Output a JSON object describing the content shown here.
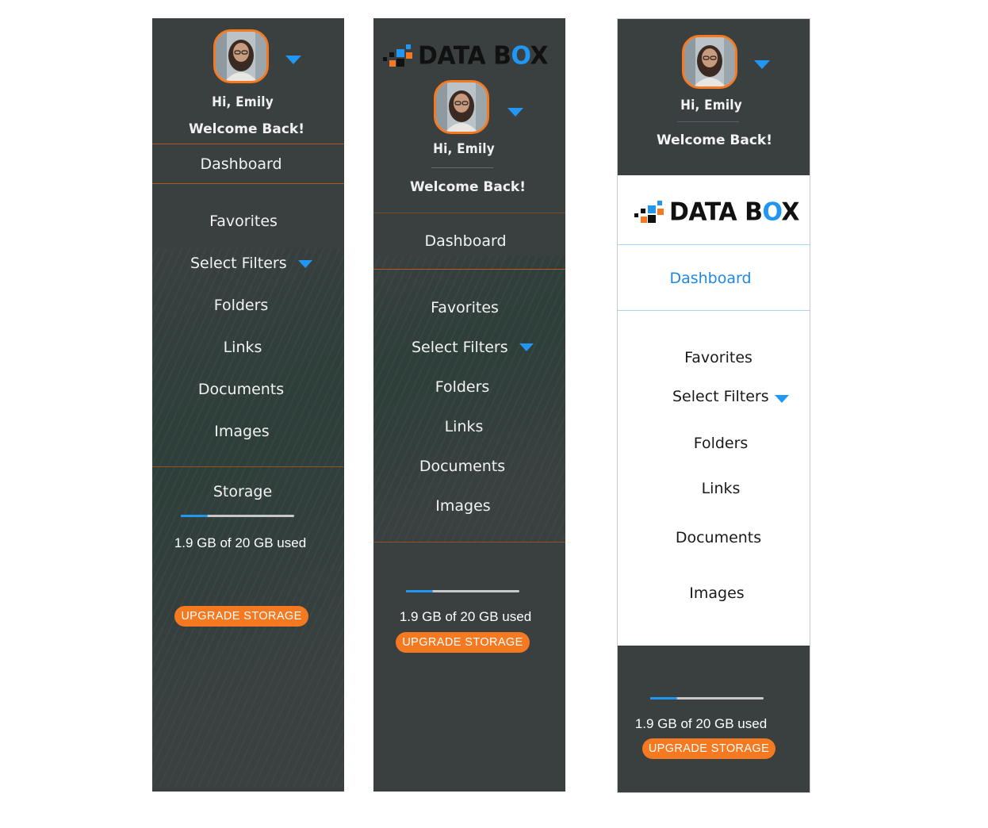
{
  "user": {
    "greeting": "Hi, Emily",
    "welcome": "Welcome Back!",
    "avatar_alt": "Emily profile photo"
  },
  "brand": {
    "name_part1": "DATA B",
    "name_o": "O",
    "name_part2": "X",
    "accent_orange": "#f47920",
    "accent_blue": "#2196f3",
    "panel_bg": "#3a3f40"
  },
  "nav": {
    "dashboard": "Dashboard",
    "favorites": "Favorites",
    "select_filters": "Select Filters",
    "folders": "Folders",
    "links": "Links",
    "documents": "Documents",
    "images": "Images"
  },
  "storage": {
    "heading": "Storage",
    "used_text": "1.9 GB of 20 GB used",
    "used_fraction": 0.24,
    "upgrade_label": "UPGRADE STORAGE"
  }
}
